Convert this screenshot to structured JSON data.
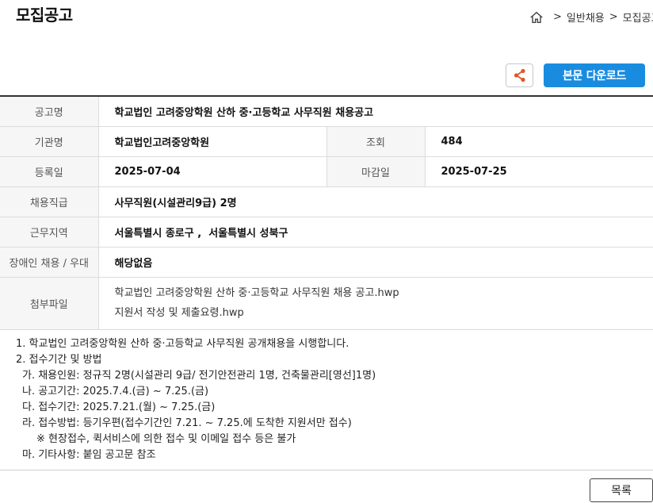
{
  "page_title": "모집공고",
  "breadcrumb": {
    "items": [
      "일반채용",
      "모집공고"
    ]
  },
  "actions": {
    "download_label": "본문 다운로드"
  },
  "colors": {
    "accent": "#1a8ce0",
    "share_icon": "#e0562b"
  },
  "info": {
    "notice_name": {
      "label": "공고명",
      "value": "학교법인 고려중앙학원 산하 중·고등학교 사무직원 채용공고"
    },
    "org": {
      "label": "기관명",
      "value": "학교법인고려중앙학원"
    },
    "views": {
      "label": "조회",
      "value": "484"
    },
    "reg_date": {
      "label": "등록일",
      "value": "2025-07-04"
    },
    "deadline": {
      "label": "마감일",
      "value": "2025-07-25"
    },
    "job": {
      "label": "채용직급",
      "value": "사무직원(시설관리9급) 2명"
    },
    "location": {
      "label": "근무지역",
      "value": "서울특별시 종로구 ,  서울특별시 성북구"
    },
    "disabled": {
      "label": "장애인 채용 / 우대",
      "value": "해당없음"
    },
    "attachments": {
      "label": "첨부파일",
      "files": [
        "학교법인 고려중앙학원 산하 중·고등학교 사무직원 채용 공고.hwp",
        "지원서 작성 및 제출요령.hwp"
      ]
    }
  },
  "body": {
    "lines": [
      "1. 학교법인 고려중앙학원 산하 중·고등학교 사무직원 공개채용을 시행합니다.",
      "2. 접수기간 및 방법",
      "가. 채용인원: 정규직 2명(시설관리 9급/ 전기안전관리 1명, 건축물관리[영선]1명)",
      "나. 공고기간: 2025.7.4.(금) ~ 7.25.(금)",
      "다. 접수기간: 2025.7.21.(월) ~ 7.25.(금)",
      "라. 접수방법: 등기우편(접수기간인 7.21. ~  7.25.에 도착한 지원서만 접수)",
      "※ 현장접수, 퀵서비스에 의한 접수 및 이메일 접수 등은 불가",
      "마. 기타사항: 붙임 공고문 참조"
    ]
  },
  "footer": {
    "list_label": "목록"
  }
}
